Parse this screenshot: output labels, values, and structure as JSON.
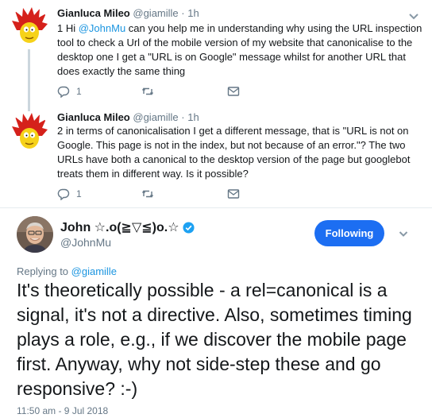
{
  "thread": [
    {
      "name": "Gianluca Mileo",
      "handle": "@giamille",
      "separator": "·",
      "time": "1h",
      "text_prefix": "1 Hi ",
      "mention": "@JohnMu",
      "text_rest": " can you help me in understanding why using the URL inspection tool to check a Url of the mobile version of my website that canonicalise to the desktop one I get a \"URL is on Google\" message whilst for another URL that does exactly the same thing",
      "reply_count": "1"
    },
    {
      "name": "Gianluca Mileo",
      "handle": "@giamille",
      "separator": "·",
      "time": "1h",
      "text": "2 in terms of canonicalisation I get a different message, that is \"URL is not on Google. This page is not in the index, but not because of an error.\"? The two URLs have both a canonical to the desktop version of the page but googlebot treats them in different way. Is it possible?",
      "reply_count": "1"
    }
  ],
  "main_tweet": {
    "name": "John ☆.o(≧▽≦)o.☆",
    "handle": "@JohnMu",
    "follow_label": "Following",
    "replying_label": "Replying to ",
    "replying_handle": "@giamille",
    "text": "It's theoretically possible - a rel=canonical is a signal, it's not a directive. Also, sometimes timing plays a role, e.g., if we discover the mobile page first. Anyway, why not side-step these and go responsive? :-)",
    "timestamp": "11:50 am - 9 Jul 2018"
  },
  "colors": {
    "link": "#1b95e0",
    "follow_button": "#1c6ef2",
    "muted": "#657786",
    "thread_line": "#ccd6dd"
  },
  "icons": [
    "reply-icon",
    "retweet-icon",
    "message-icon",
    "chevron-down-icon",
    "verified-badge-icon"
  ]
}
